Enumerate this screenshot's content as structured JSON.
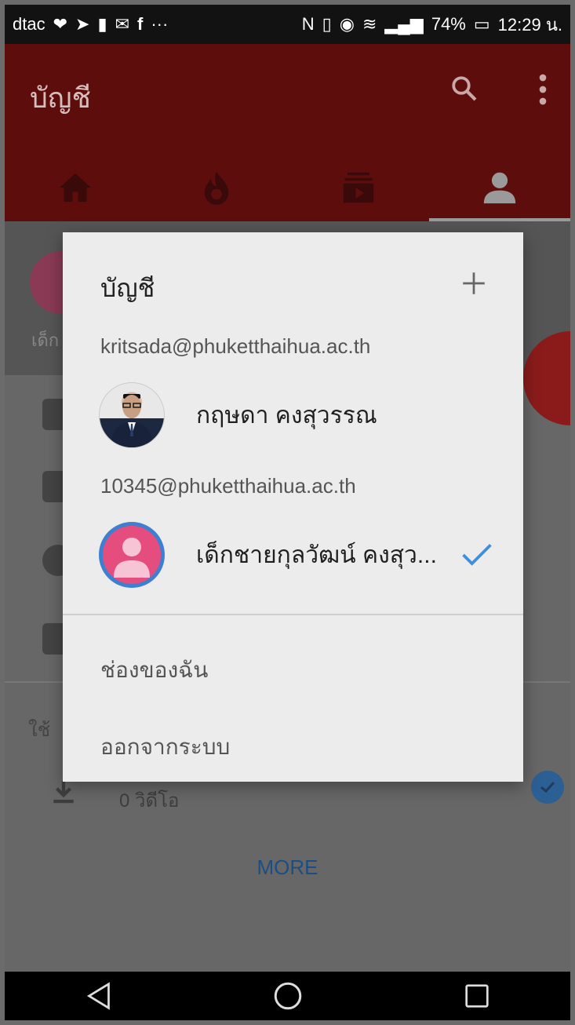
{
  "status_bar": {
    "carrier": "dtac",
    "notification_icons": [
      "health-icon",
      "navigation-icon",
      "battery-alert-icon",
      "gmail-icon",
      "facebook-icon"
    ],
    "overflow": "···",
    "battery_percent": "74%",
    "time": "12:29 น."
  },
  "app_bar": {
    "title": "บัญชี",
    "tabs": [
      {
        "icon": "home-icon",
        "active": false
      },
      {
        "icon": "trending-icon",
        "active": false
      },
      {
        "icon": "subscriptions-icon",
        "active": false
      },
      {
        "icon": "account-icon",
        "active": true
      }
    ]
  },
  "background": {
    "use_label": "ใช้",
    "downloads_label": "0 วิดีโอ",
    "more_label": "MORE",
    "partial_text": "เด็ก"
  },
  "dialog": {
    "title": "บัญชี",
    "accounts": [
      {
        "email": "kritsada@phuketthaihua.ac.th",
        "name": "กฤษดา คงสุวรรณ",
        "selected": false
      },
      {
        "email": "10345@phuketthaihua.ac.th",
        "name": "เด็กชายกุลวัฒน์ คงสุว...",
        "selected": true
      }
    ],
    "menu": {
      "my_channel": "ช่องของฉัน",
      "sign_out": "ออกจากระบบ"
    }
  },
  "colors": {
    "app_bar": "#5e0d0d",
    "dialog_bg": "#ececec",
    "accent_blue": "#3d8fe0",
    "avatar_pink": "#e64d7f"
  }
}
